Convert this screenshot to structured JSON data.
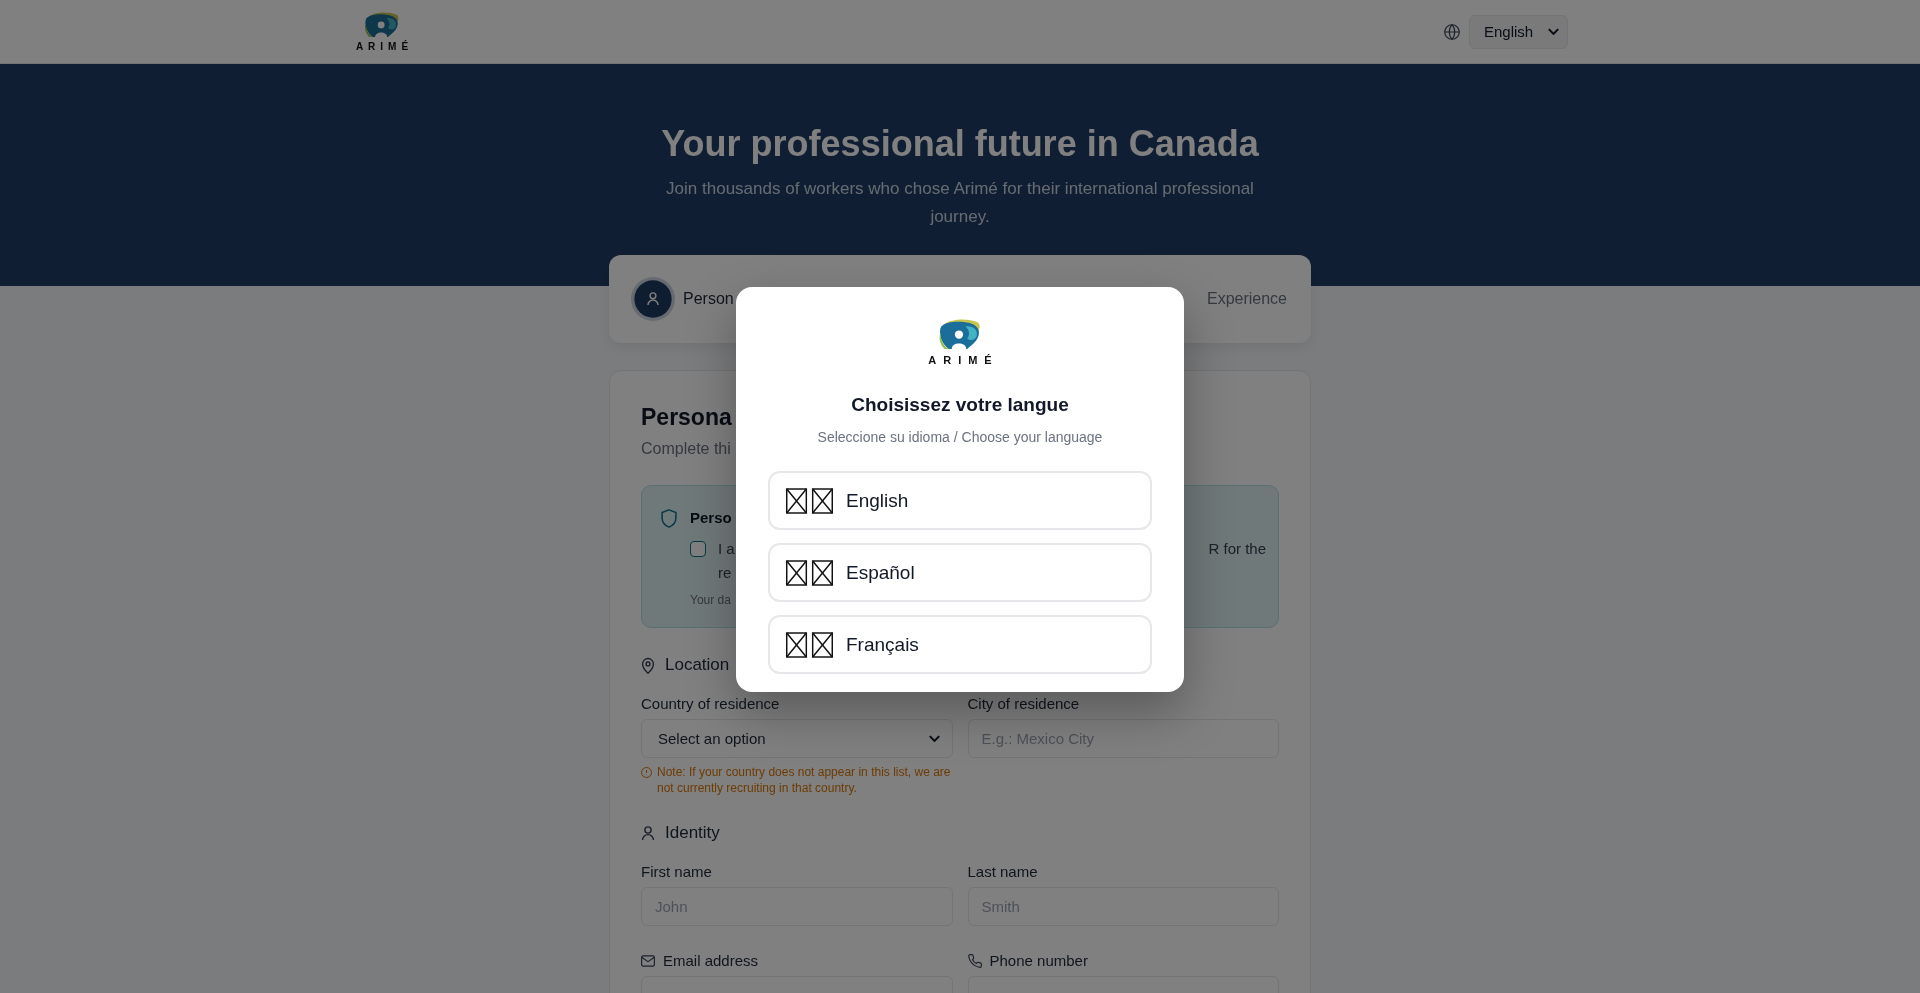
{
  "header": {
    "logo": {
      "wordmark": "ARIMÉ"
    },
    "language_select": {
      "value": "English"
    }
  },
  "hero": {
    "title": "Your professional future in Canada",
    "subtitle": "Join thousands of workers who chose Arimé for their international professional journey."
  },
  "stepper": {
    "steps": [
      {
        "label": "Person",
        "selected": true
      },
      {
        "label": "Experience",
        "selected": false
      }
    ]
  },
  "form": {
    "title": "Persona",
    "subtitle": "Complete thi",
    "privacy_notice": {
      "title": "Perso",
      "consent": {
        "checked": false,
        "line_1_left": "I a",
        "line_1_right": "R for the",
        "line_2": "re"
      },
      "note": "Your da"
    },
    "sections": [
      {
        "kind": "location",
        "title": "Location",
        "fields": [
          {
            "kind": "select",
            "label": "Country of residence",
            "value": "Select an option",
            "note": "Note: If your country does not appear in this list, we are not currently recruiting in that country."
          },
          {
            "kind": "text",
            "label": "City of residence",
            "placeholder": "E.g.: Mexico City"
          }
        ]
      },
      {
        "kind": "identity",
        "title": "Identity",
        "fields": [
          {
            "kind": "text",
            "label": "First name",
            "placeholder": "John"
          },
          {
            "kind": "text",
            "label": "Last name",
            "placeholder": "Smith"
          },
          {
            "kind": "email",
            "label": "Email address"
          },
          {
            "kind": "phone",
            "label": "Phone number"
          }
        ]
      }
    ]
  },
  "language_modal": {
    "open": true,
    "logo": {
      "wordmark": "ARIMÉ"
    },
    "title": "Choisissez votre langue",
    "subtitle": "Seleccione su idioma / Choose your language",
    "options": [
      {
        "label": "English"
      },
      {
        "label": "Español"
      },
      {
        "label": "Français"
      }
    ]
  }
}
